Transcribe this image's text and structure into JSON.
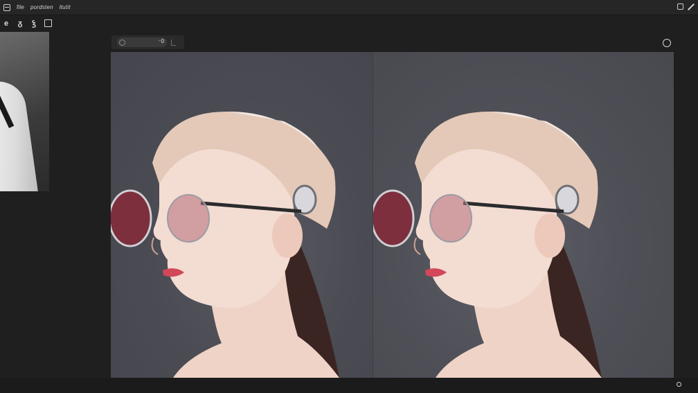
{
  "menubar": {
    "items": [
      {
        "label": "file"
      },
      {
        "label": "pordsten"
      },
      {
        "label": "ltutit"
      }
    ]
  },
  "toolbar": {
    "tools": [
      "e",
      "ᵹ",
      "ꝣ"
    ]
  },
  "canvas_toolbar": {
    "zoom_value": "⁻0"
  },
  "colors": {
    "background": "#1f1f1f",
    "viewport": "#4a4a52",
    "skin": "#f1d9cf",
    "helmet": "#e6cdbd",
    "lens": "#8a3a48"
  },
  "icons": {
    "app": "app-icon",
    "pen": "pen-icon",
    "chat": "chat-icon",
    "status": "status-icon"
  }
}
